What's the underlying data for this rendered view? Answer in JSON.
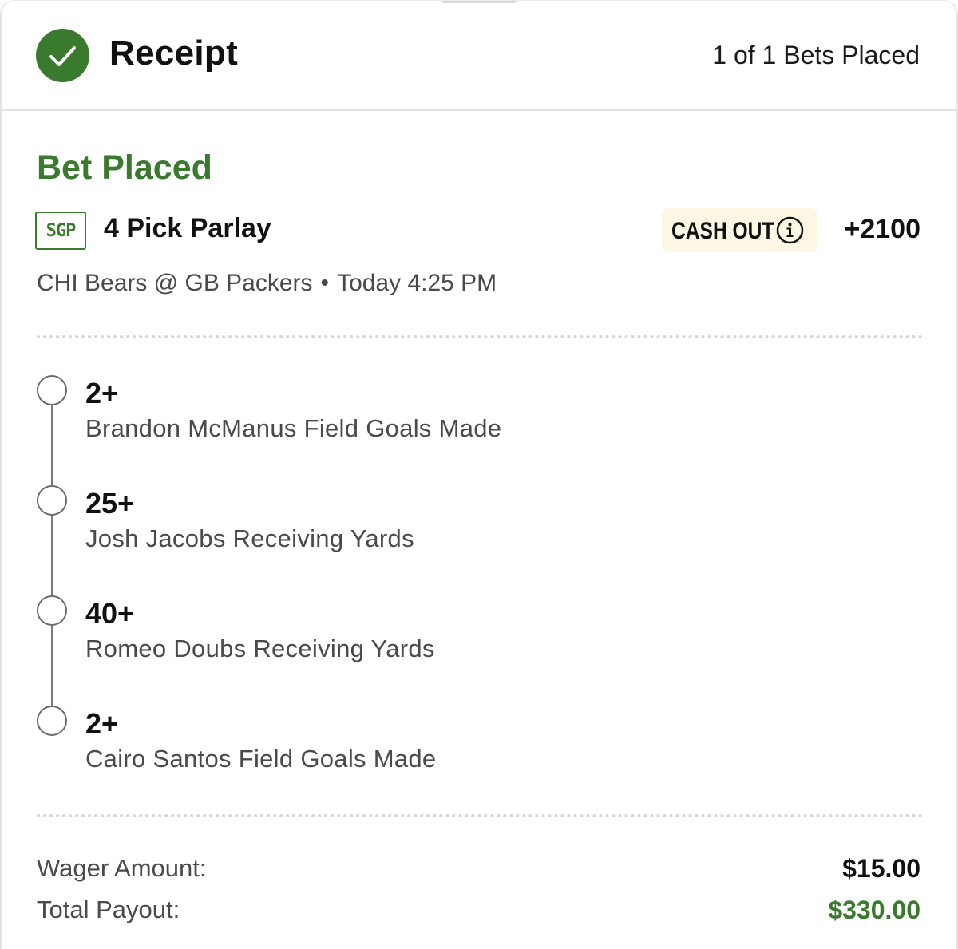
{
  "header": {
    "title": "Receipt",
    "bets_placed": "1 of 1 Bets Placed",
    "check_color": "#3a7a2e"
  },
  "bet": {
    "status": "Bet Placed",
    "badge": "SGP",
    "title": "4 Pick Parlay",
    "cashout_label": "CASH OUT",
    "odds": "+2100",
    "event": "CHI Bears @ GB Packers",
    "time": "Today 4:25 PM",
    "accent_color": "#3a7a2e"
  },
  "legs": [
    {
      "line": "2+",
      "market": "Brandon McManus Field Goals Made"
    },
    {
      "line": "25+",
      "market": "Josh Jacobs Receiving Yards"
    },
    {
      "line": "40+",
      "market": "Romeo Doubs Receiving Yards"
    },
    {
      "line": "2+",
      "market": "Cairo Santos Field Goals Made"
    }
  ],
  "summary": {
    "wager_label": "Wager Amount:",
    "wager_value": "$15.00",
    "payout_label": "Total Payout:",
    "payout_value": "$330.00",
    "payout_color": "#3a7a2e"
  }
}
